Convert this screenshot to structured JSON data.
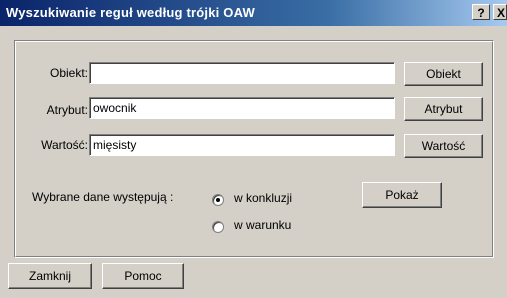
{
  "window": {
    "title": "Wyszukiwanie reguł według trójki OAW",
    "help_label": "?",
    "close_label": "X"
  },
  "form": {
    "object_label": "Obiekt:",
    "object_value": "",
    "attribute_label": "Atrybut:",
    "attribute_value": "owocnik",
    "value_label": "Wartość:",
    "value_value": "mięsisty"
  },
  "side_buttons": {
    "object": "Obiekt",
    "attribute": "Atrybut",
    "value": "Wartość"
  },
  "occurrence": {
    "label": "Wybrane dane występują :",
    "options": [
      {
        "label": "w konkluzji",
        "selected": true
      },
      {
        "label": "w warunku",
        "selected": false
      }
    ],
    "show_button": "Pokaż"
  },
  "footer": {
    "close_button": "Zamknij",
    "help_button": "Pomoc"
  }
}
